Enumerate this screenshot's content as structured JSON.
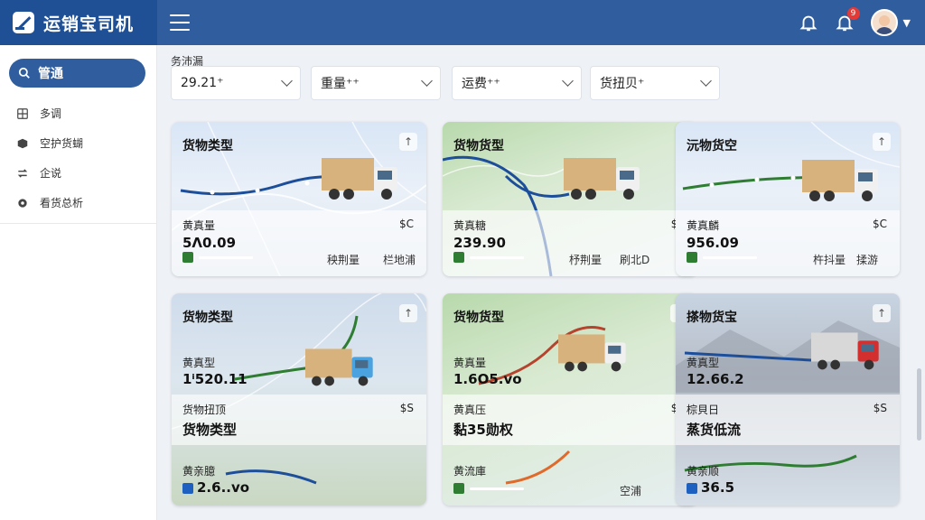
{
  "app": {
    "title": "运销宝司机"
  },
  "header": {
    "notification_count": "9"
  },
  "sidebar": {
    "search_label": "管通",
    "items": [
      {
        "label": "多调",
        "icon": "grid-icon"
      },
      {
        "label": "空护货蝴",
        "icon": "box-icon"
      },
      {
        "label": "企说",
        "icon": "transfer-icon"
      },
      {
        "label": "看货总析",
        "icon": "gear-icon"
      }
    ]
  },
  "filters": {
    "label": "务沛漏",
    "items": [
      {
        "value": "29.21⁺"
      },
      {
        "value": "重量⁺⁺"
      },
      {
        "value": "运费⁺⁺"
      },
      {
        "value": "货扭贝⁺"
      }
    ]
  },
  "cards": [
    {
      "title": "货物类型",
      "label": "黄真量",
      "unit": "$C",
      "value": "5Ʌ0.09",
      "foot1": "秧荆量",
      "foot2": "栏地浦",
      "route_color": "#1d4e9a",
      "truck_color": "#d7b27c",
      "cab_color": "#f0f0f0"
    },
    {
      "title": "货物货型",
      "label": "黄真糖",
      "unit": "$S",
      "value": "239.90",
      "foot1": "杼荆量",
      "foot2": "刷北D",
      "route_color": "#1d4e9a",
      "truck_color": "#d7b27c",
      "cab_color": "#f0f0f0"
    },
    {
      "title": "沅物货空",
      "label": "黄真麟",
      "unit": "$C",
      "value": "956.09",
      "foot1": "杵抖量",
      "foot2": "揉游",
      "route_color": "#2e7d32",
      "truck_color": "#d7b27c",
      "cab_color": "#f0f0f0"
    },
    {
      "title": "货物类型",
      "label": "黄真型",
      "unit": "",
      "value": "1ⁱ520.11",
      "sub_label": "货物扭顶",
      "sub_unit": "$S",
      "sub_title": "货物类型",
      "bottom_label": "黄亲臆",
      "bottom_value": "2.6..vo",
      "route_color": "#2e7d32",
      "truck_color": "#d7b27c",
      "cab_color": "#4aa3df"
    },
    {
      "title": "货物货型",
      "label": "黄真量",
      "unit": "",
      "value": "1.6O5.vo",
      "sub_label": "黄真压",
      "sub_unit": "$S",
      "sub_title": "黏35勋权",
      "bottom_label": "黄流庫",
      "bottom_value": "",
      "foot2": "空浦",
      "route_color": "#b5432d",
      "truck_color": "#d7b27c",
      "cab_color": "#f0f0f0"
    },
    {
      "title": "搽物货宝",
      "label": "黄真型",
      "unit": "",
      "value": "12.66.2",
      "sub_label": "棕貝日",
      "sub_unit": "$S",
      "sub_title": "蒸货低流",
      "bottom_label": "黄亲顺",
      "bottom_value": "36.5",
      "route_color": "#1d4e9a",
      "truck_color": "#d8d8d8",
      "cab_color": "#d32f2f"
    }
  ]
}
